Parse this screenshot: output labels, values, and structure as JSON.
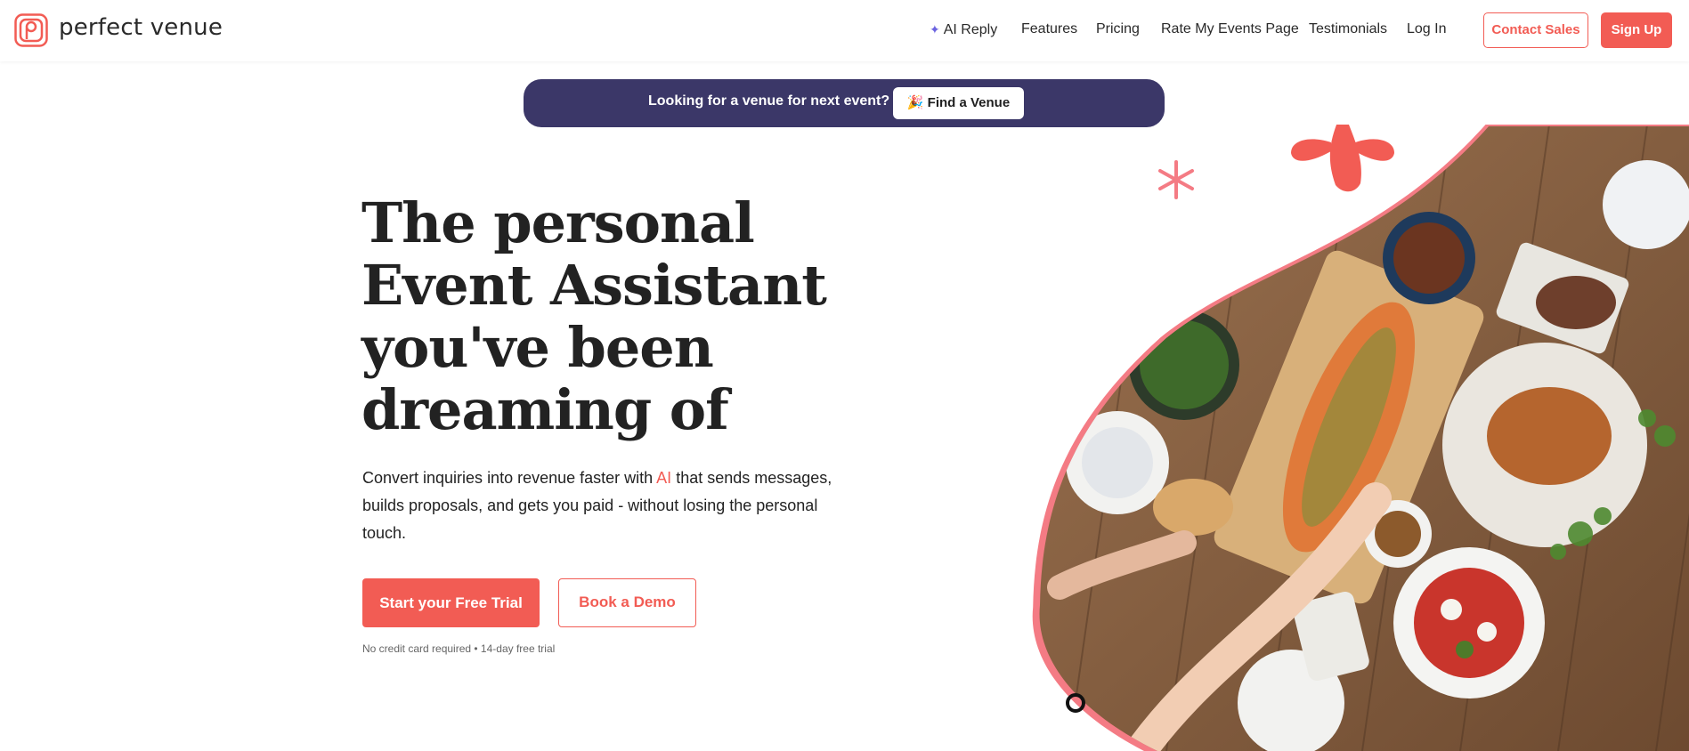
{
  "header": {
    "brand": "perfect venue",
    "nav": [
      {
        "label": "AI Reply",
        "icon": "sparkle-icon"
      },
      {
        "label": "Features"
      },
      {
        "label": "Pricing"
      },
      {
        "label": "Rate My Events Page"
      },
      {
        "label": "Testimonials"
      },
      {
        "label": "Log In"
      }
    ],
    "contact_sales": "Contact Sales",
    "sign_up": "Sign Up"
  },
  "banner": {
    "text": "Looking for a venue for next event?",
    "button_icon": "🎉",
    "button_label": "Find a Venue"
  },
  "hero": {
    "title_lines": [
      "The personal",
      "Event Assistant",
      "you've been",
      "dreaming of"
    ],
    "subtitle_before": "Convert inquiries into revenue faster with ",
    "subtitle_highlight": "AI",
    "subtitle_after": " that sends messages, builds proposals, and gets you paid - without losing the personal touch.",
    "cta_primary": "Start your Free Trial",
    "cta_secondary": "Book a Demo",
    "fine_print": "No credit card required • 14-day free trial"
  },
  "colors": {
    "accent": "#f25c54",
    "banner_bg": "#3b3768",
    "blob_border": "#f47b84",
    "sparkle": "#6b63e0"
  },
  "image": {
    "icon": "food-table-photo"
  }
}
